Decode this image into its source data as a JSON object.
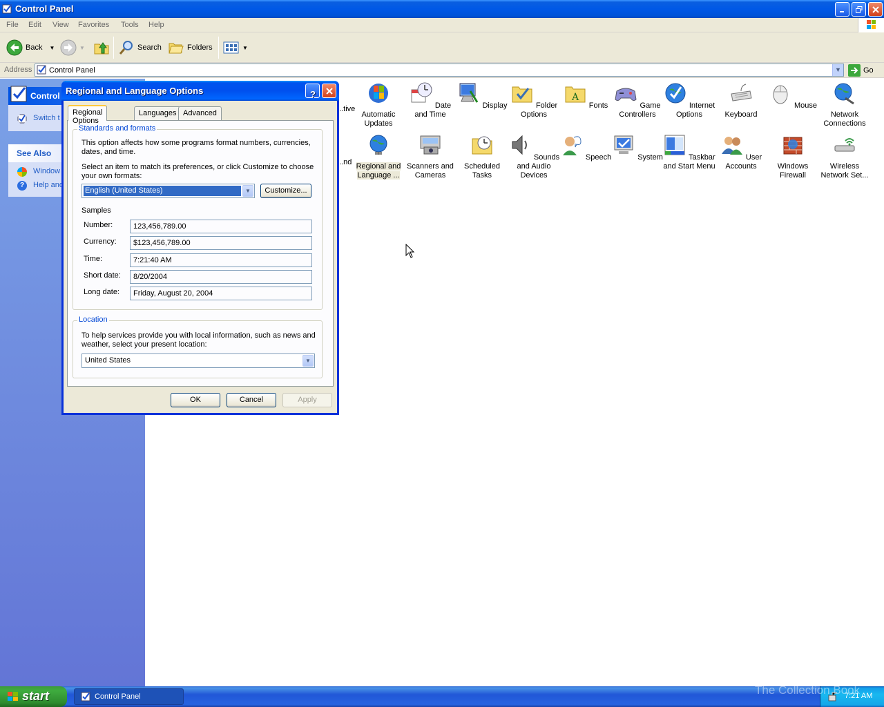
{
  "window": {
    "title": "Control Panel"
  },
  "menu": [
    "File",
    "Edit",
    "View",
    "Favorites",
    "Tools",
    "Help"
  ],
  "toolbar": {
    "back": "Back",
    "search": "Search",
    "folders": "Folders"
  },
  "address": {
    "label": "Address",
    "value": "Control Panel",
    "go": "Go"
  },
  "sidebar": {
    "panel_title": "Control",
    "switch_link": "Switch t",
    "see_also_title": "See Also",
    "see_also_items": [
      "Window",
      "Help and"
    ]
  },
  "icons": [
    {
      "label": "...tive"
    },
    {
      "label": "Automatic Updates"
    },
    {
      "label": "Date and Time"
    },
    {
      "label": "Display"
    },
    {
      "label": "Folder Options"
    },
    {
      "label": "Fonts"
    },
    {
      "label": "Game Controllers"
    },
    {
      "label": "Internet Options"
    },
    {
      "label": "Keyboard"
    },
    {
      "label": "Mouse"
    },
    {
      "label": "Network Connections"
    },
    {
      "label": "...nd"
    },
    {
      "label": "Regional and Language ..."
    },
    {
      "label": "Scanners and Cameras"
    },
    {
      "label": "Scheduled Tasks"
    },
    {
      "label": "Sounds and Audio Devices"
    },
    {
      "label": "Speech"
    },
    {
      "label": "System"
    },
    {
      "label": "Taskbar and Start Menu"
    },
    {
      "label": "User Accounts"
    },
    {
      "label": "Windows Firewall"
    },
    {
      "label": "Wireless Network Set..."
    }
  ],
  "dialog": {
    "title": "Regional and Language Options",
    "tabs": [
      "Regional Options",
      "Languages",
      "Advanced"
    ],
    "standards": {
      "legend": "Standards and formats",
      "desc": "This option affects how some programs format numbers, currencies, dates, and time.",
      "select_prompt": "Select an item to match its preferences, or click Customize to choose your own formats:",
      "selected_format": "English (United States)",
      "customize_label": "Customize...",
      "samples_title": "Samples",
      "samples": [
        {
          "label": "Number:",
          "value": "123,456,789.00"
        },
        {
          "label": "Currency:",
          "value": "$123,456,789.00"
        },
        {
          "label": "Time:",
          "value": "7:21:40 AM"
        },
        {
          "label": "Short date:",
          "value": "8/20/2004"
        },
        {
          "label": "Long date:",
          "value": "Friday, August 20, 2004"
        }
      ]
    },
    "location": {
      "legend": "Location",
      "desc": "To help services provide you with local information, such as news and weather, select your present location:",
      "value": "United States"
    },
    "buttons": {
      "ok": "OK",
      "cancel": "Cancel",
      "apply": "Apply"
    }
  },
  "taskbar": {
    "start": "start",
    "task": "Control Panel",
    "clock": "7:21 AM",
    "watermark": "The Collection Book"
  }
}
